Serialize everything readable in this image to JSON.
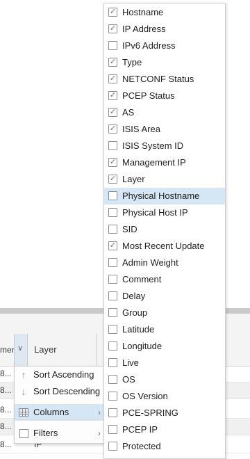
{
  "grid": {
    "header_partial": "men",
    "layer_header": "Layer",
    "rows": [
      {
        "c1": "8...",
        "c2": ""
      },
      {
        "c1": "8...",
        "c2": ""
      },
      {
        "c1": "8...",
        "c2": ""
      },
      {
        "c1": "8...",
        "c2": ""
      },
      {
        "c1": "8...",
        "c2": "IP"
      }
    ]
  },
  "column_menu": {
    "sort_asc": "Sort Ascending",
    "sort_desc": "Sort Descending",
    "columns": "Columns",
    "filters": "Filters"
  },
  "columns": [
    {
      "label": "Hostname",
      "checked": true
    },
    {
      "label": "IP Address",
      "checked": true
    },
    {
      "label": "IPv6 Address",
      "checked": false
    },
    {
      "label": "Type",
      "checked": true
    },
    {
      "label": "NETCONF Status",
      "checked": true
    },
    {
      "label": "PCEP Status",
      "checked": true
    },
    {
      "label": "AS",
      "checked": true
    },
    {
      "label": "ISIS Area",
      "checked": true
    },
    {
      "label": "ISIS System ID",
      "checked": false
    },
    {
      "label": "Management IP",
      "checked": true
    },
    {
      "label": "Layer",
      "checked": true
    },
    {
      "label": "Physical Hostname",
      "checked": false,
      "highlighted": true
    },
    {
      "label": "Physical Host IP",
      "checked": false
    },
    {
      "label": "SID",
      "checked": false
    },
    {
      "label": "Most Recent Update",
      "checked": true
    },
    {
      "label": "Admin Weight",
      "checked": false
    },
    {
      "label": "Comment",
      "checked": false
    },
    {
      "label": "Delay",
      "checked": false
    },
    {
      "label": "Group",
      "checked": false
    },
    {
      "label": "Latitude",
      "checked": false
    },
    {
      "label": "Longitude",
      "checked": false
    },
    {
      "label": "Live",
      "checked": false
    },
    {
      "label": "OS",
      "checked": false
    },
    {
      "label": "OS Version",
      "checked": false
    },
    {
      "label": "PCE-SPRING",
      "checked": false
    },
    {
      "label": "PCEP IP",
      "checked": false
    },
    {
      "label": "Protected",
      "checked": false
    }
  ]
}
